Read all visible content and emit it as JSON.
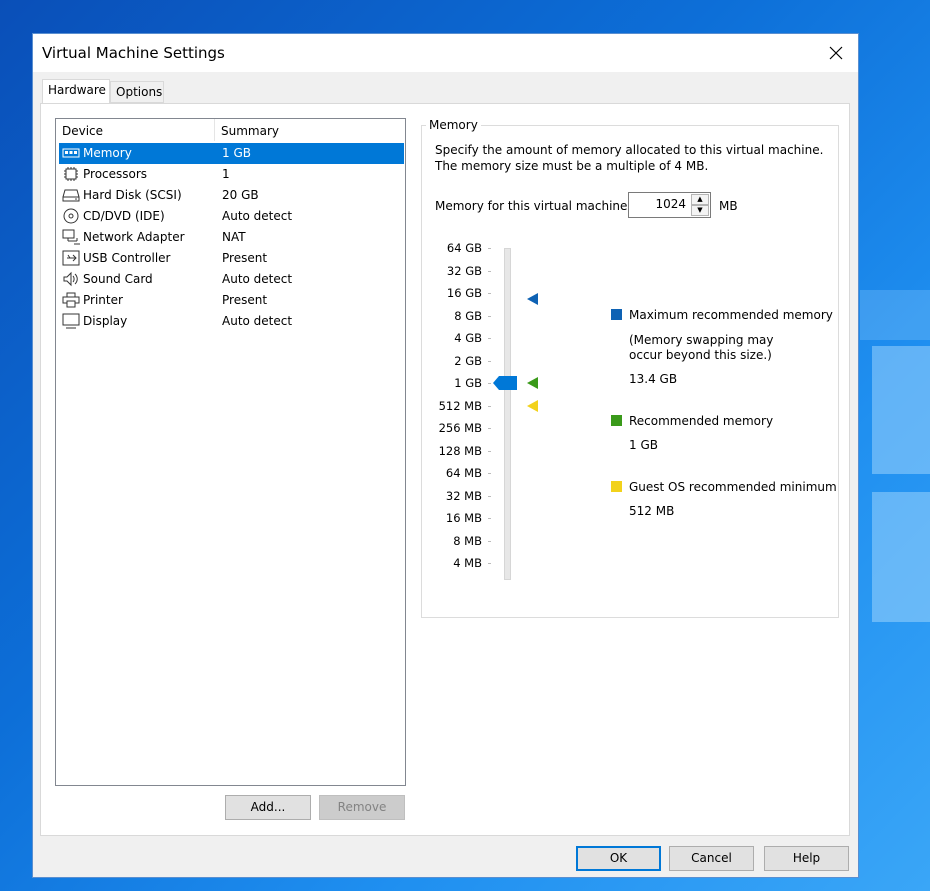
{
  "window": {
    "title": "Virtual Machine Settings"
  },
  "tabs": [
    {
      "label": "Hardware"
    },
    {
      "label": "Options"
    }
  ],
  "device_list": {
    "headers": {
      "device": "Device",
      "summary": "Summary"
    },
    "rows": [
      {
        "name": "Memory",
        "summary": "1 GB",
        "icon": "memory-icon",
        "selected": true
      },
      {
        "name": "Processors",
        "summary": "1",
        "icon": "processor-icon"
      },
      {
        "name": "Hard Disk (SCSI)",
        "summary": "20 GB",
        "icon": "hard-disk-icon"
      },
      {
        "name": "CD/DVD (IDE)",
        "summary": "Auto detect",
        "icon": "cd-dvd-icon"
      },
      {
        "name": "Network Adapter",
        "summary": "NAT",
        "icon": "network-adapter-icon"
      },
      {
        "name": "USB Controller",
        "summary": "Present",
        "icon": "usb-icon"
      },
      {
        "name": "Sound Card",
        "summary": "Auto detect",
        "icon": "speaker-icon"
      },
      {
        "name": "Printer",
        "summary": "Present",
        "icon": "printer-icon"
      },
      {
        "name": "Display",
        "summary": "Auto detect",
        "icon": "display-icon"
      }
    ]
  },
  "list_buttons": {
    "add": "Add...",
    "remove": "Remove"
  },
  "memory": {
    "group_label": "Memory",
    "desc_line1": "Specify the amount of memory allocated to this virtual machine.",
    "desc_line2": "The memory size must be a multiple of 4 MB.",
    "field_label": "Memory for this virtual machine:",
    "value": "1024",
    "unit": "MB",
    "scale": [
      "64 GB",
      "32 GB",
      "16 GB",
      "8 GB",
      "4 GB",
      "2 GB",
      "1 GB",
      "512 MB",
      "256 MB",
      "128 MB",
      "64 MB",
      "32 MB",
      "16 MB",
      "8 MB",
      "4 MB"
    ],
    "slider_level": "1 GB",
    "legend": {
      "max_label": "Maximum recommended memory",
      "max_note1": "(Memory swapping may",
      "max_note2": "occur beyond this size.)",
      "max_value": "13.4 GB",
      "rec_label": "Recommended memory",
      "rec_value": "1 GB",
      "min_label": "Guest OS recommended minimum",
      "min_value": "512 MB"
    }
  },
  "colors": {
    "max": "#0e62b4",
    "recommended": "#3a9a1a",
    "minimum": "#f2d21b",
    "selection": "#0078d7"
  },
  "footer": {
    "ok": "OK",
    "cancel": "Cancel",
    "help": "Help"
  }
}
